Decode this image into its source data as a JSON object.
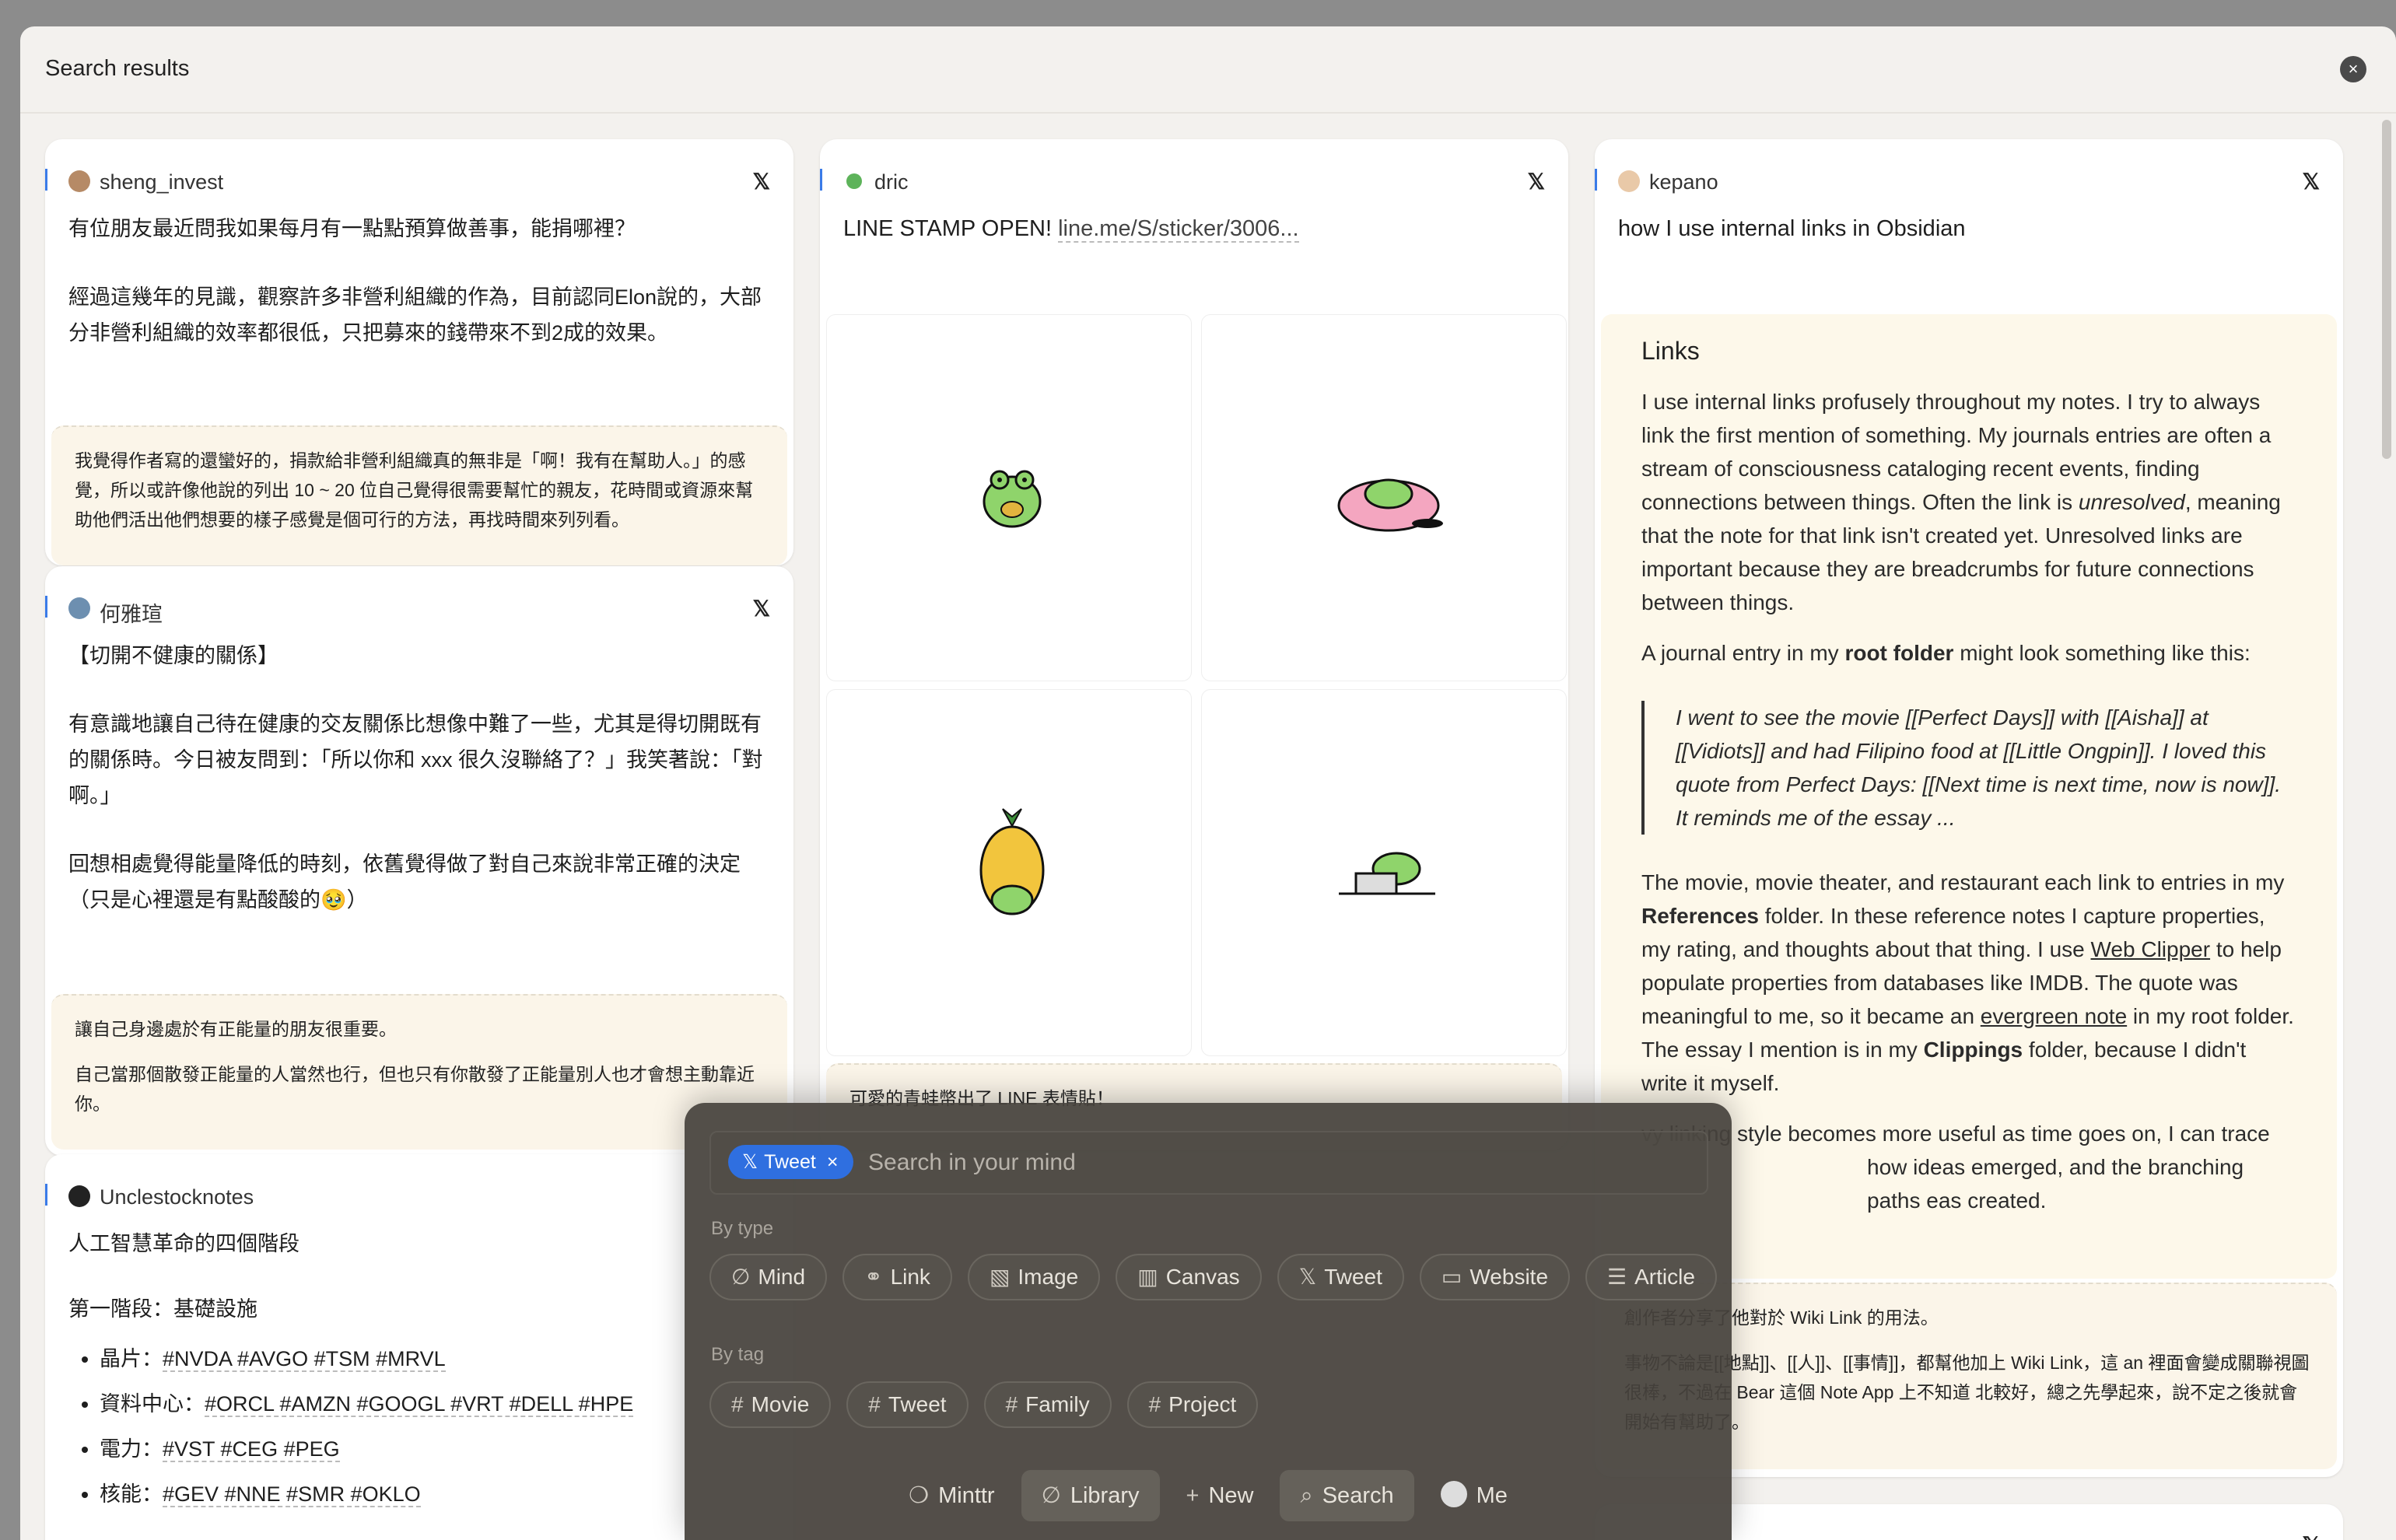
{
  "modal": {
    "title": "Search results"
  },
  "cards": {
    "c1": {
      "author": "sheng_invest",
      "paragraphs": [
        "有位朋友最近問我如果每月有一點點預算做善事，能捐哪裡？",
        "經過這幾年的見識，觀察許多非營利組織的作為，目前認同Elon說的，大部分非營利組織的效率都很低，只把募來的錢帶來不到2成的效果。"
      ],
      "note": "我覺得作者寫的還蠻好的，捐款給非營利組織真的無非是「啊！我有在幫助人。」的感覺，所以或許像他說的列出 10 ~ 20 位自己覺得很需要幫忙的親友，花時間或資源來幫助他們活出他們想要的樣子感覺是個可行的方法，再找時間來列列看。"
    },
    "c2": {
      "author": "何雅瑄",
      "paragraphs": [
        "【切開不健康的關係】",
        "有意識地讓自己待在健康的交友關係比想像中難了一些，尤其是得切開既有的關係時。今日被友問到：「所以你和 xxx 很久沒聯絡了？」我笑著說：「對啊。」",
        "回想相處覺得能量降低的時刻，依舊覺得做了對自己來說非常正確的決定（只是心裡還是有點酸酸的🥹）"
      ],
      "note": [
        "讓自己身邊處於有正能量的朋友很重要。",
        "自己當那個散發正能量的人當然也行，但也只有你散發了正能量別人也才會想主動靠近你。"
      ]
    },
    "c3": {
      "author": "Unclestocknotes",
      "title": "人工智慧革命的四個階段",
      "stage": "第一階段：基礎設施",
      "items": [
        {
          "label": "晶片：",
          "tags": "#NVDA #AVGO #TSM #MRVL"
        },
        {
          "label": "資料中心：",
          "tags": "#ORCL #AMZN #GOOGL #VRT #DELL #HPE"
        },
        {
          "label": "電力：",
          "tags": "#VST #CEG #PEG"
        },
        {
          "label": "核能：",
          "tags": "#GEV #NNE #SMR #OKLO"
        }
      ]
    },
    "c4": {
      "author": "dric",
      "text": "LINE STAMP OPEN! ",
      "link": "line.me/S/sticker/3006...",
      "note": "可愛的青蛙幣出了 LINE 表情貼！"
    },
    "c5": {
      "author": "kepano",
      "title": "how I use internal links in Obsidian",
      "embed": {
        "heading": "Links",
        "p1a": "I use internal links profusely throughout my notes. I try to always link the first mention of something. My journals entries are often a stream of consciousness cataloging recent events, finding connections between things. Often the link is ",
        "p1em": "unresolved",
        "p1b": ", meaning that the note for that link isn't created yet. Unresolved links are important because they are breadcrumbs for future connections between things.",
        "p2a": "A journal entry in my ",
        "p2b": "root folder",
        "p2c": " might look something like this:",
        "quote": "I went to see the movie [[Perfect Days]] with [[Aisha]] at [[Vidiots]] and had Filipino food at [[Little Ongpin]]. I loved this quote from Perfect Days: [[Next time is next time, now is now]]. It reminds me of the essay ...",
        "p3a": "The movie, movie theater, and restaurant each link to entries in my ",
        "p3b": "References",
        "p3c": " folder. In these reference notes I capture properties, my rating, and thoughts about that thing. I use ",
        "p3d": "Web Clipper",
        "p3e": " to help populate properties from databases like IMDB. The quote was meaningful to me, so it became an ",
        "p3f": "evergreen note",
        "p3g": " in my root folder. The essay I mention is in my ",
        "p3h": "Clippings",
        "p3i": " folder, because I didn't write it myself.",
        "p4": "vy linking style becomes more useful as time goes on, I can trace how ideas emerged, and the branching paths eas created."
      },
      "note": [
        "創作者分享了他對於 Wiki Link 的用法。",
        "事物不論是[[地點]]、[[人]]、[[事情]]，都幫他加上 Wiki Link，這 an 裡面會變成關聯視圖很棒，不過在 Bear 這個 Note App 上不知道 北較好，總之先學起來，說不定之後就會開始有幫助了。"
      ]
    }
  },
  "palette": {
    "chip_label": "Tweet",
    "search_placeholder": "Search in your mind",
    "by_type_label": "By type",
    "types": [
      {
        "icon": "∅",
        "label": "Mind"
      },
      {
        "icon": "⚭",
        "label": "Link"
      },
      {
        "icon": "▧",
        "label": "Image"
      },
      {
        "icon": "▥",
        "label": "Canvas"
      },
      {
        "icon": "𝕏",
        "label": "Tweet"
      },
      {
        "icon": "▭",
        "label": "Website"
      },
      {
        "icon": "☰",
        "label": "Article"
      }
    ],
    "by_tag_label": "By tag",
    "tags": [
      {
        "icon": "#",
        "label": "Movie"
      },
      {
        "icon": "#",
        "label": "Tweet"
      },
      {
        "icon": "#",
        "label": "Family"
      },
      {
        "icon": "#",
        "label": "Project"
      }
    ],
    "nav": [
      {
        "icon": "❍",
        "label": "Minttr"
      },
      {
        "icon": "∅",
        "label": "Library"
      },
      {
        "icon": "+",
        "label": "New"
      },
      {
        "icon": "⌕",
        "label": "Search"
      },
      {
        "icon": "",
        "label": "Me"
      }
    ]
  },
  "colors": {
    "accent": "#2f6fe0",
    "note_bg": "#fbf5e9",
    "embed_bg": "#fdf8ea"
  }
}
